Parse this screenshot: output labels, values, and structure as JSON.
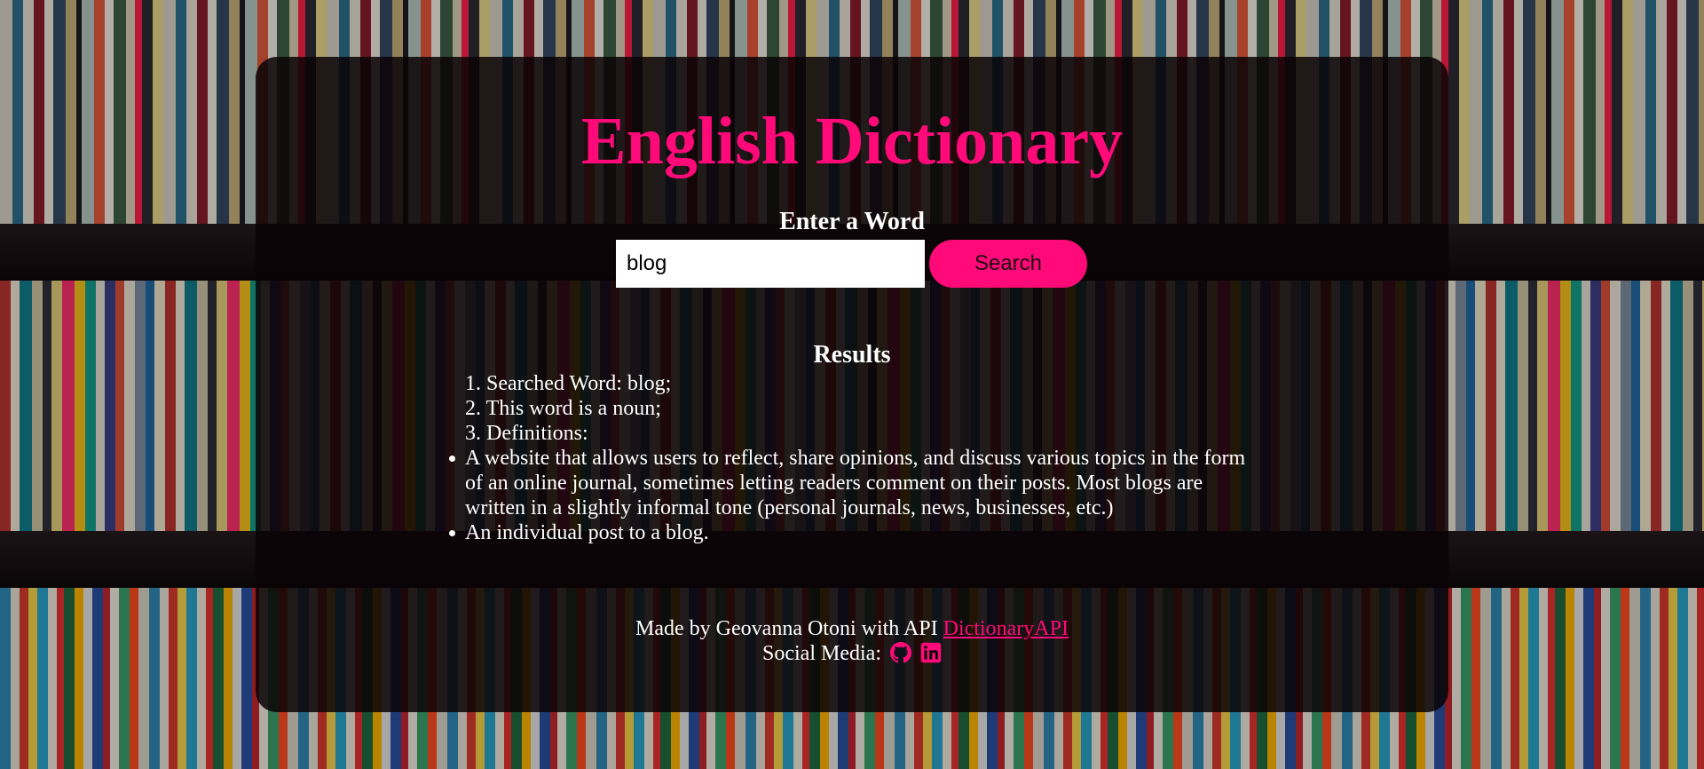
{
  "header": {
    "title": "English Dictionary",
    "prompt": "Enter a Word"
  },
  "search": {
    "value": "blog",
    "button_label": "Search"
  },
  "results": {
    "heading": "Results",
    "items": [
      "1. Searched Word: blog;",
      "2. This word is a noun;",
      "3. Definitions:"
    ],
    "definitions": [
      "A website that allows users to reflect, share opinions, and discuss various topics in the form of an online journal, sometimes letting readers comment on their posts. Most blogs are written in a slightly informal tone (personal journals, news, businesses, etc.)",
      "An individual post to a blog."
    ]
  },
  "footer": {
    "credit_text": "Made by Geovanna Otoni with API",
    "api_link": "DictionaryAPI",
    "social_label": "Social Media:",
    "social_icons": [
      "github-icon",
      "linkedin-icon"
    ]
  },
  "colors": {
    "accent": "#ff0a78",
    "panel": "rgba(10,3,6,0.86)",
    "text": "#ffffff"
  }
}
